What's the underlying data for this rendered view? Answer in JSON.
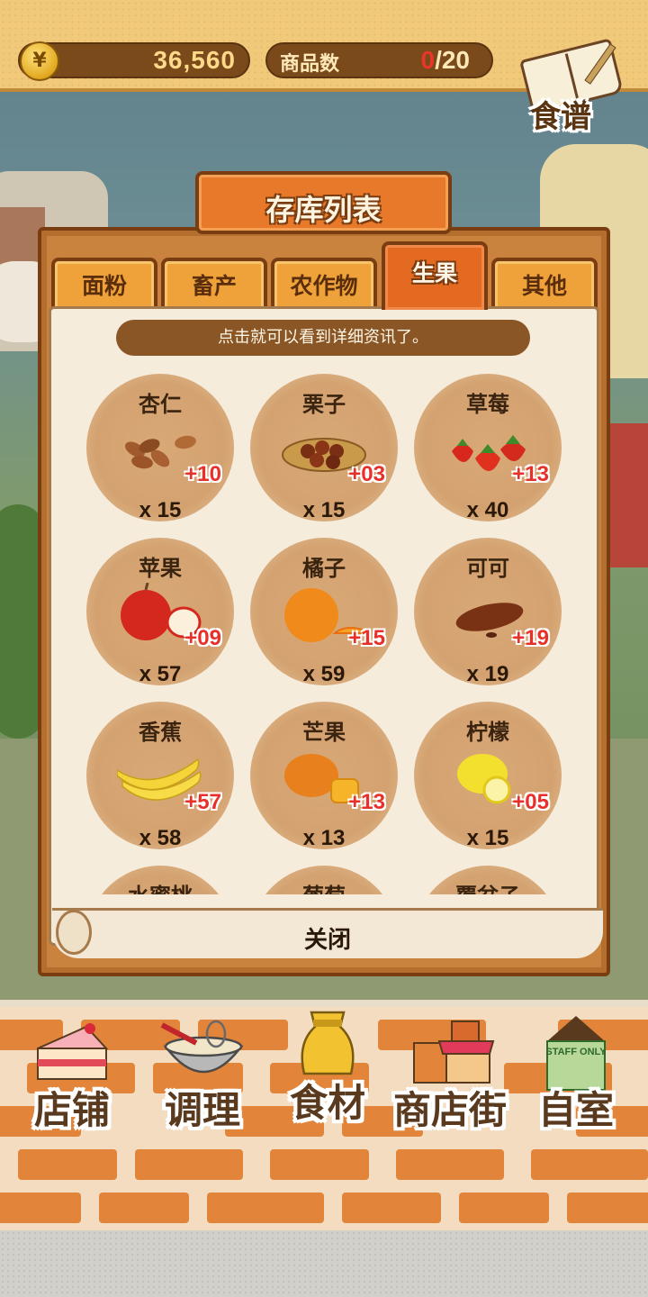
{
  "hud": {
    "coin_symbol": "¥",
    "money": "36,560",
    "goods_label": "商品数",
    "goods_current": "0",
    "goods_max": "/20",
    "recipe_label": "食谱"
  },
  "modal": {
    "title": "存库列表",
    "tabs": [
      {
        "label": "面粉",
        "active": false
      },
      {
        "label": "畜产",
        "active": false
      },
      {
        "label": "农作物",
        "active": false
      },
      {
        "label": "生果",
        "active": true
      },
      {
        "label": "其他",
        "active": false
      }
    ],
    "hint": "点击就可以看到详细资讯了。",
    "items": [
      {
        "name": "杏仁",
        "bonus": "+10",
        "qty": "x 15",
        "icon": "almond-icon"
      },
      {
        "name": "栗子",
        "bonus": "+03",
        "qty": "x 15",
        "icon": "chestnut-icon"
      },
      {
        "name": "草莓",
        "bonus": "+13",
        "qty": "x 40",
        "icon": "strawberry-icon"
      },
      {
        "name": "苹果",
        "bonus": "+09",
        "qty": "x 57",
        "icon": "apple-icon"
      },
      {
        "name": "橘子",
        "bonus": "+15",
        "qty": "x 59",
        "icon": "orange-icon"
      },
      {
        "name": "可可",
        "bonus": "+19",
        "qty": "x 19",
        "icon": "cacao-icon"
      },
      {
        "name": "香蕉",
        "bonus": "+57",
        "qty": "x 58",
        "icon": "banana-icon"
      },
      {
        "name": "芒果",
        "bonus": "+13",
        "qty": "x 13",
        "icon": "mango-icon"
      },
      {
        "name": "柠檬",
        "bonus": "+05",
        "qty": "x 15",
        "icon": "lemon-icon"
      },
      {
        "name": "水蜜桃",
        "bonus": "",
        "qty": "",
        "icon": ""
      },
      {
        "name": "葡萄",
        "bonus": "",
        "qty": "",
        "icon": ""
      },
      {
        "name": "覆盆子",
        "bonus": "",
        "qty": "",
        "icon": ""
      }
    ],
    "close_label": "关闭"
  },
  "nav": [
    {
      "label": "店铺",
      "icon": "cake-icon"
    },
    {
      "label": "调理",
      "icon": "mixing-bowl-icon"
    },
    {
      "label": "食材",
      "icon": "flour-sack-icon"
    },
    {
      "label": "商店街",
      "icon": "shop-street-icon"
    },
    {
      "label": "自室",
      "icon": "staff-only-door-icon"
    }
  ],
  "nav_staff_sign": "STAFF ONLY",
  "colors": {
    "accent_orange": "#e46a22",
    "bonus_red": "#e8302a",
    "wood_brown": "#7a3d12"
  }
}
